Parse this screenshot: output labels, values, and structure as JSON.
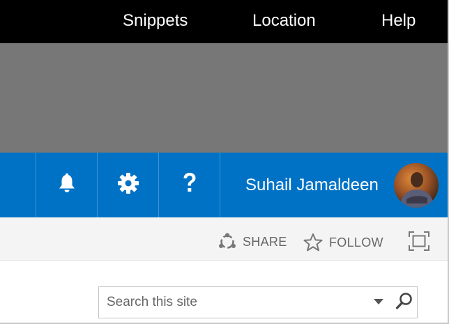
{
  "top_nav": {
    "items": [
      {
        "label": "Snippets"
      },
      {
        "label": "Location"
      },
      {
        "label": "Help"
      }
    ]
  },
  "suite_bar": {
    "background": "#0072c6",
    "notifications_icon": "bell-icon",
    "settings_icon": "gear-icon",
    "help_icon": "question-mark-icon",
    "user_name": "Suhail Jamaldeen"
  },
  "action_bar": {
    "share_label": "SHARE",
    "share_icon": "share-icon",
    "follow_label": "FOLLOW",
    "follow_icon": "star-icon",
    "focus_icon": "focus-on-content-icon"
  },
  "search": {
    "placeholder": "Search this site",
    "value": "",
    "dropdown_icon": "caret-down-icon",
    "search_icon": "magnifier-icon"
  }
}
